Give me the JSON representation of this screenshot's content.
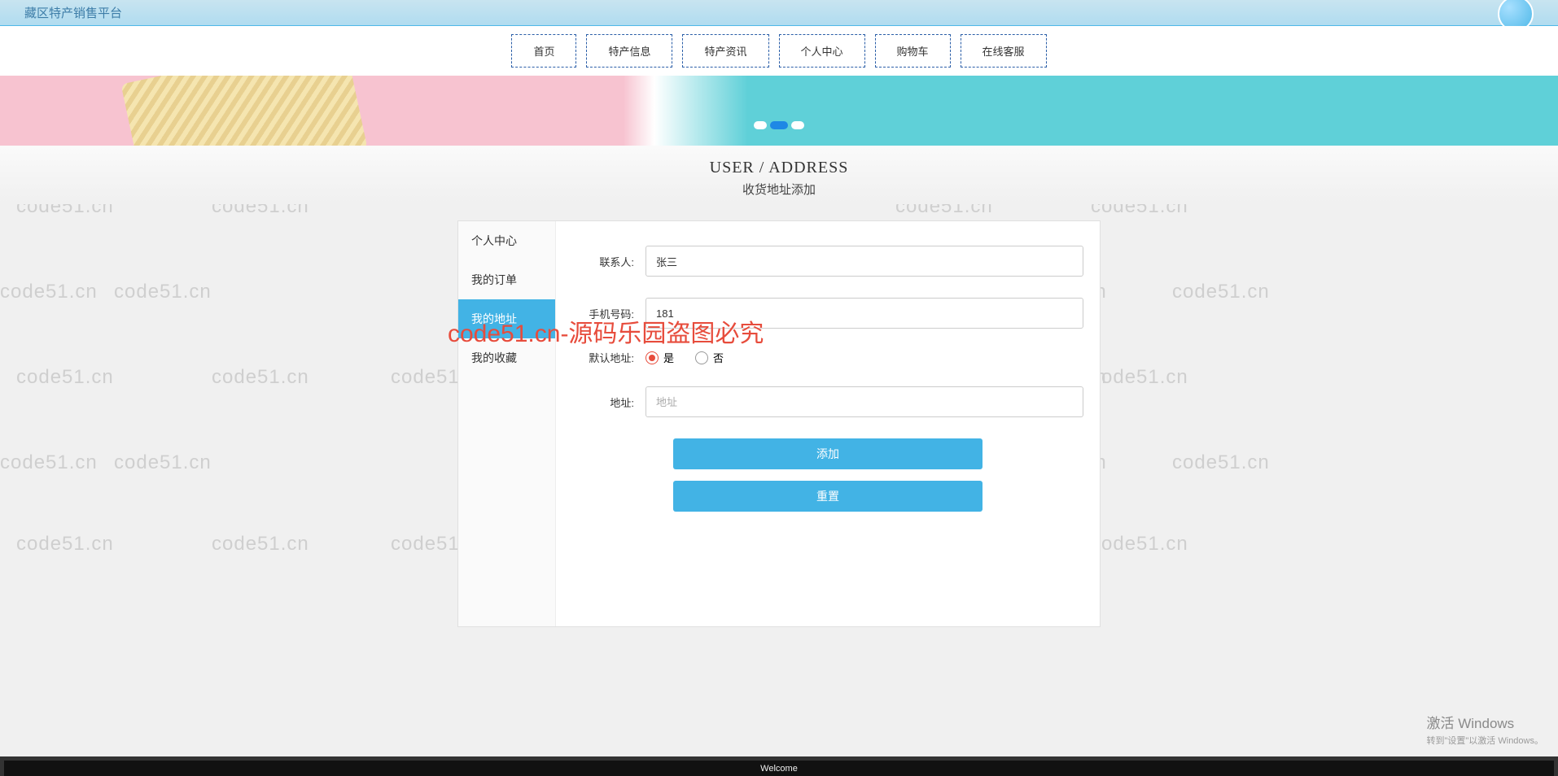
{
  "site_title": "藏区特产销售平台",
  "nav": {
    "items": [
      {
        "label": "首页"
      },
      {
        "label": "特产信息"
      },
      {
        "label": "特产资讯"
      },
      {
        "label": "个人中心"
      },
      {
        "label": "购物车"
      },
      {
        "label": "在线客服"
      }
    ]
  },
  "heading": {
    "en": "USER / ADDRESS",
    "cn": "收货地址添加"
  },
  "sidebar": {
    "items": [
      {
        "label": "个人中心",
        "active": false
      },
      {
        "label": "我的订单",
        "active": false
      },
      {
        "label": "我的地址",
        "active": true
      },
      {
        "label": "我的收藏",
        "active": false
      }
    ]
  },
  "form": {
    "contact": {
      "label": "联系人:",
      "value": "张三"
    },
    "phone": {
      "label": "手机号码:",
      "value": "181"
    },
    "default_addr": {
      "label": "默认地址:",
      "yes": "是",
      "no": "否",
      "selected": "yes"
    },
    "address": {
      "label": "地址:",
      "placeholder": "地址",
      "value": ""
    },
    "submit": "添加",
    "reset": "重置"
  },
  "watermark": {
    "text": "code51.cn",
    "center": "code51.cn-源码乐园盗图必究"
  },
  "activate": {
    "title": "激活 Windows",
    "sub": "转到\"设置\"以激活 Windows。"
  },
  "bottom": "Welcome"
}
